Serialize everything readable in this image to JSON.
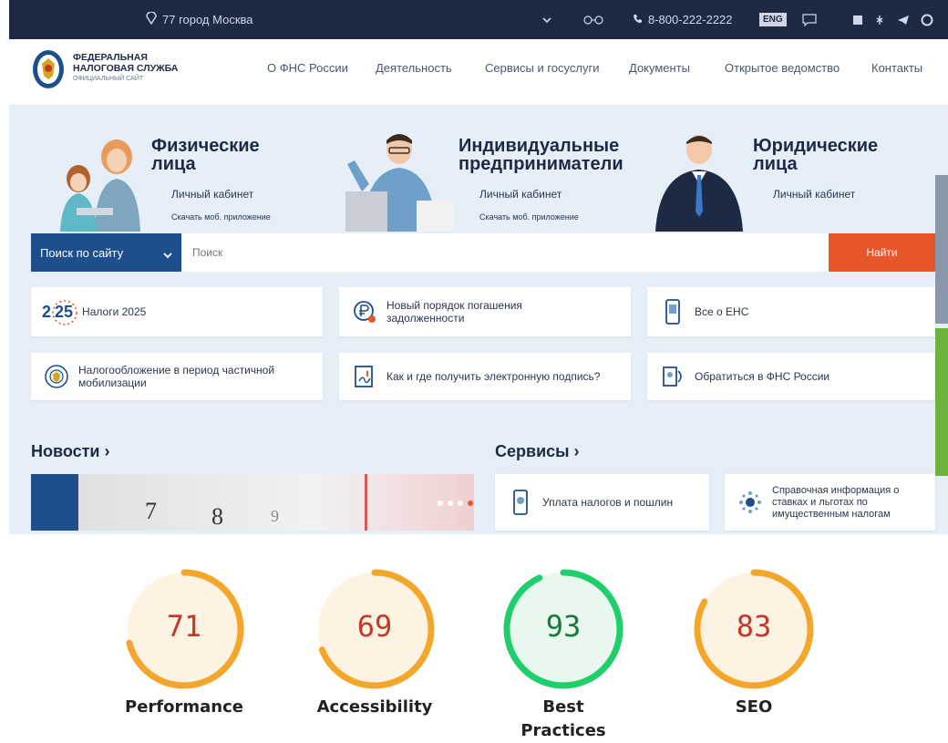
{
  "topbar": {
    "region": "77 город Москва",
    "phone": "8-800-222-2222",
    "lang": "ENG"
  },
  "header": {
    "logo_line1": "ФЕДЕРАЛЬНАЯ",
    "logo_line2": "НАЛОГОВАЯ СЛУЖБА",
    "logo_sub": "ОФИЦИАЛЬНЫЙ САЙТ",
    "nav": [
      "О ФНС России",
      "Деятельность",
      "Сервисы и госуслуги",
      "Документы",
      "Открытое ведомство",
      "Контакты"
    ]
  },
  "hero": {
    "sections": [
      {
        "title1": "Физические",
        "title2": "лица",
        "link": "Личный кабинет",
        "sub": "Скачать моб. приложение"
      },
      {
        "title1": "Индивидуальные",
        "title2": "предприниматели",
        "link": "Личный кабинет",
        "sub": "Скачать моб. приложение"
      },
      {
        "title1": "Юридические",
        "title2": "лица",
        "link": "Личный кабинет",
        "sub": ""
      }
    ]
  },
  "search": {
    "select_value": "Поиск по сайту",
    "placeholder": "Поиск",
    "button": "Найти"
  },
  "cards": [
    {
      "label": "Налоги 2025",
      "badge_left": "2",
      "badge_right": "25"
    },
    {
      "label": "Новый порядок погашения задолженности"
    },
    {
      "label": "Все о ЕНС"
    },
    {
      "label": "Налогообложение в период частичной мобилизации"
    },
    {
      "label": "Как и где получить электронную подпись?"
    },
    {
      "label": "Обратиться в ФНС России"
    }
  ],
  "news": {
    "title": "Новости",
    "calendar_nums": [
      "7",
      "8",
      "9"
    ]
  },
  "services": {
    "title": "Сервисы",
    "items": [
      {
        "label": "Уплата налогов и пошлин"
      },
      {
        "label": "Справочная информация о ставках и льготах по имущественным налогам"
      }
    ]
  },
  "scores": [
    {
      "value": 71,
      "label": "Performance",
      "color": "#f4a62a",
      "bg": "#fdf3e3",
      "text_color": "#c0392b"
    },
    {
      "value": 69,
      "label": "Accessibility",
      "color": "#f4a62a",
      "bg": "#fdf3e3",
      "text_color": "#c0392b"
    },
    {
      "value": 93,
      "label": "Best Practices",
      "color": "#1fcf6b",
      "bg": "#e8f8ee",
      "text_color": "#1a7a3e"
    },
    {
      "value": 83,
      "label": "SEO",
      "color": "#f4a62a",
      "bg": "#fdf3e3",
      "text_color": "#c0392b"
    }
  ],
  "colors": {
    "topbar": "#1e2a44",
    "accent_blue": "#1f4e8c",
    "accent_orange": "#e7552a",
    "hero_bg": "#e6eef7"
  }
}
